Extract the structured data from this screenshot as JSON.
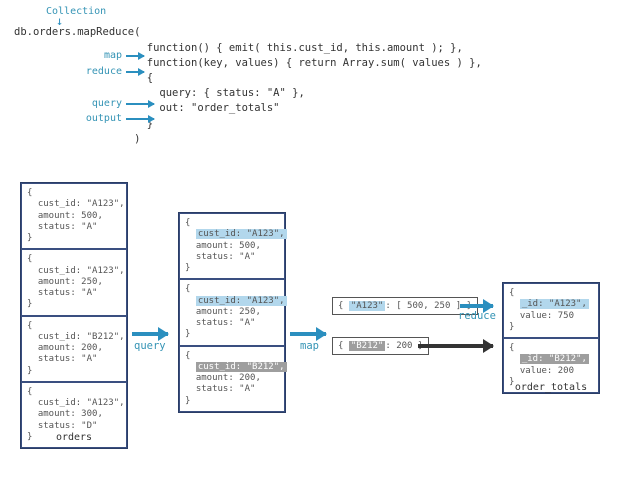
{
  "labels": {
    "collection": "Collection",
    "map": "map",
    "reduce": "reduce",
    "query": "query",
    "output": "output"
  },
  "code": {
    "line0": "db.orders.mapReduce(",
    "line1": "                     function() { emit( this.cust_id, this.amount ); },",
    "line2": "                     function(key, values) { return Array.sum( values ) },",
    "line3": "                     {",
    "line4": "                       query: { status: \"A\" },",
    "line5": "                       out: \"order_totals\"",
    "line6": "                     }",
    "line7": "                   )"
  },
  "orders": {
    "title": "orders",
    "d0": "{\n  cust_id: \"A123\",\n  amount: 500,\n  status: \"A\"\n}",
    "d1": "{\n  cust_id: \"A123\",\n  amount: 250,\n  status: \"A\"\n}",
    "d2": "{\n  cust_id: \"B212\",\n  amount: 200,\n  status: \"A\"\n}",
    "d3": "{\n  cust_id: \"A123\",\n  amount: 300,\n  status: \"D\"\n}"
  },
  "filtered": {
    "d0": {
      "pre": "{\n  ",
      "hl": "cust_id: \"A123\",",
      "post": "\n  amount: 500,\n  status: \"A\"\n}"
    },
    "d1": {
      "pre": "{\n  ",
      "hl": "cust_id: \"A123\",",
      "post": "\n  amount: 250,\n  status: \"A\"\n}"
    },
    "d2": {
      "pre": "{\n  ",
      "hl": "cust_id: \"B212\",",
      "post": "\n  amount: 200,\n  status: \"A\"\n}"
    }
  },
  "mapped": {
    "pA": {
      "pre": "{ ",
      "hl": "\"A123\"",
      "post": ": [ 500, 250 ] }"
    },
    "pB": {
      "pre": "{ ",
      "hl": "\"B212\"",
      "post": ": 200 }"
    }
  },
  "results": {
    "title": "order_totals",
    "r0": {
      "pre": "{\n  ",
      "hl": "_id: \"A123\",",
      "post": "\n  value: 750\n}"
    },
    "r1": {
      "pre": "{\n  ",
      "hl": "_id: \"B212\",",
      "post": "\n  value: 200\n}"
    }
  },
  "flow_labels": {
    "query": "query",
    "map": "map",
    "reduce": "reduce"
  }
}
